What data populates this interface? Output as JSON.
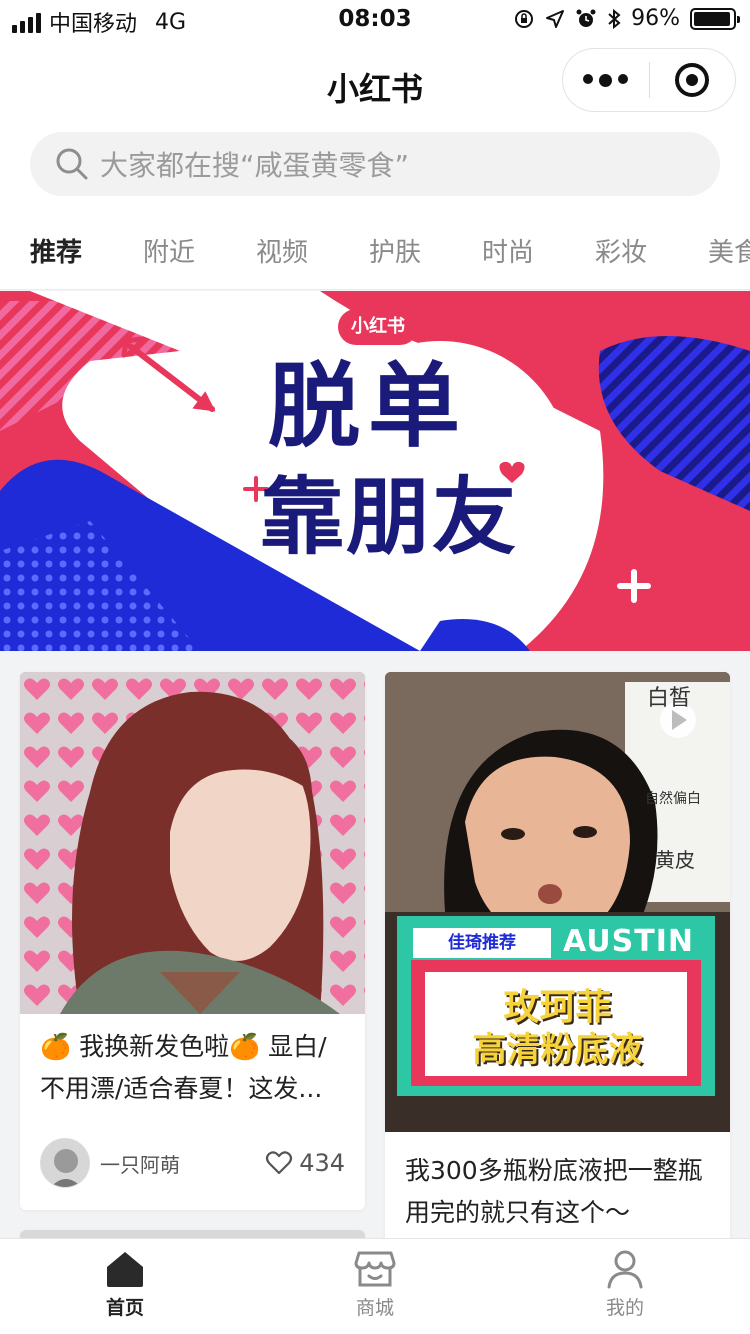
{
  "status_bar": {
    "carrier": "中国移动",
    "network": "4G",
    "time": "08:03",
    "battery": "96%",
    "battery_level": 0.96
  },
  "title_bar": {
    "title": "小红书"
  },
  "search": {
    "placeholder": "大家都在搜“咸蛋黄零食”"
  },
  "tabs": [
    {
      "label": "推荐",
      "active": true
    },
    {
      "label": "附近"
    },
    {
      "label": "视频"
    },
    {
      "label": "护肤"
    },
    {
      "label": "时尚"
    },
    {
      "label": "彩妆"
    },
    {
      "label": "美食"
    }
  ],
  "banner": {
    "badge": "小红书",
    "line1": "脱单",
    "line2": "靠朋友"
  },
  "feed": [
    {
      "title": "🍊 我换新发色啦🍊 显白/不用漂/适合春夏！这发...",
      "author": "一只阿萌",
      "likes": "434"
    },
    {
      "title": "我300多瓶粉底液把一整瓶用完的就只有这个～",
      "overlay_tag": "佳琦推荐",
      "overlay_brand": "AUSTIN",
      "overlay_line1": "玫珂菲",
      "overlay_line2": "高清粉底液",
      "board_text_1": "白皙",
      "board_text_2": "自然偏白",
      "board_text_3": "黄皮"
    }
  ],
  "tab_bar": [
    {
      "label": "首页",
      "icon": "home-icon",
      "active": true
    },
    {
      "label": "商城",
      "icon": "store-icon"
    },
    {
      "label": "我的",
      "icon": "profile-icon"
    }
  ],
  "colors": {
    "brand_red": "#e8375a",
    "banner_blue": "#1f2bd6",
    "banner_navy": "#1a1a7a"
  }
}
